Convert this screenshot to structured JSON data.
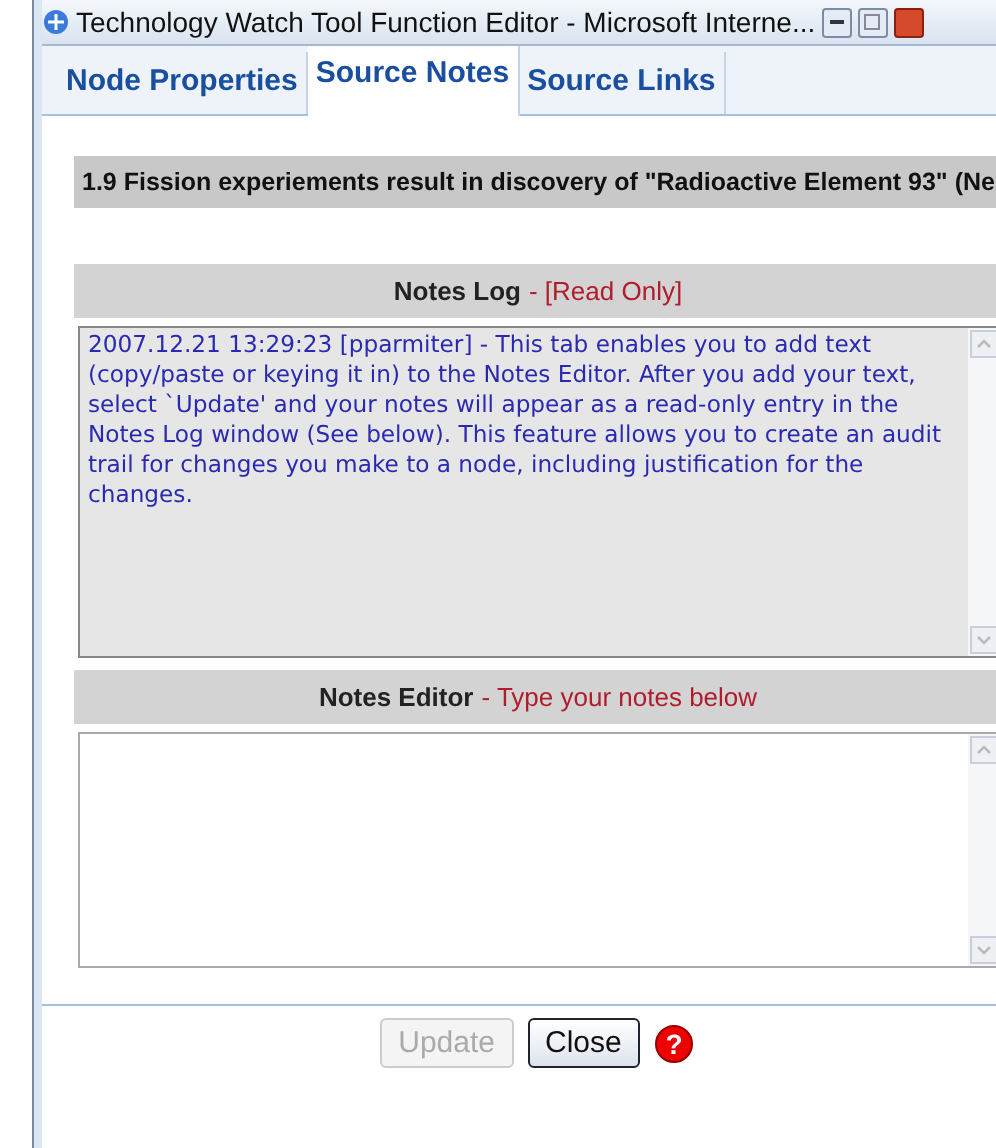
{
  "window": {
    "title": "Technology Watch Tool Function Editor - Microsoft Interne..."
  },
  "tabs": [
    {
      "label": "Node Properties",
      "selected": false
    },
    {
      "label": "Source Notes",
      "selected": true
    },
    {
      "label": "Source Links",
      "selected": false
    }
  ],
  "node_heading": "1.9 Fission experiements result in discovery of \"Radioactive Element 93\" (Ne",
  "notes_log": {
    "title": "Notes Log",
    "note": "- [Read Only]",
    "text": "2007.12.21 13:29:23 [pparmiter] - This tab enables you to add text (copy/paste or keying it in) to the Notes Editor. After you add your text, select `Update' and your notes will appear as a read-only entry in the Notes Log window (See below). This feature allows you to create an audit trail for changes you make to a node, including justification for the changes."
  },
  "notes_editor": {
    "title": "Notes Editor",
    "note": "- Type your notes below"
  },
  "buttons": [
    {
      "label": "Update",
      "disabled": true
    },
    {
      "label": "Close",
      "disabled": false
    }
  ],
  "help_glyph": "?"
}
